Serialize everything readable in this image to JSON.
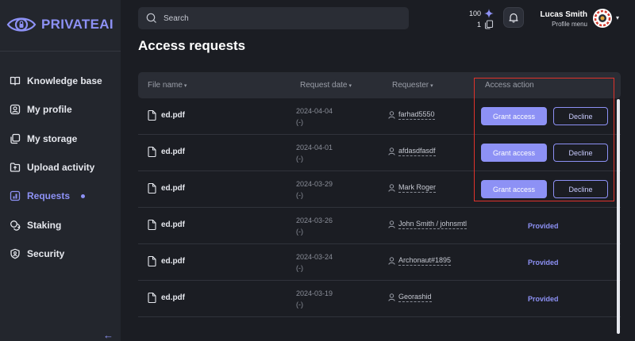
{
  "app": {
    "name": "PRIVATEAI",
    "brand_color": "#8d91f5"
  },
  "sidebar": {
    "items": [
      {
        "label": "Knowledge base",
        "icon": "book-icon"
      },
      {
        "label": "My profile",
        "icon": "profile-icon"
      },
      {
        "label": "My storage",
        "icon": "storage-icon"
      },
      {
        "label": "Upload activity",
        "icon": "upload-folder-icon"
      },
      {
        "label": "Requests",
        "icon": "requests-icon",
        "active": true
      },
      {
        "label": "Staking",
        "icon": "coins-icon"
      },
      {
        "label": "Security",
        "icon": "shield-icon"
      }
    ],
    "collapse_label": "←"
  },
  "header": {
    "search_placeholder": "Search",
    "tokens": "100",
    "files": "1",
    "user_name": "Lucas Smith",
    "user_menu": "Profile menu",
    "caret": "▾"
  },
  "page_title": "Access requests",
  "table": {
    "columns": {
      "file_name": "File name",
      "request_date": "Request date",
      "requester": "Requester",
      "access_action": "Access action",
      "sort_arrow": "▾"
    },
    "grant_label": "Grant access",
    "decline_label": "Decline",
    "provided_label": "Provided",
    "rows": [
      {
        "file": "ed.pdf",
        "date": "2024-04-04",
        "sub": "(-)",
        "requester": "farhad5550",
        "status": "pending"
      },
      {
        "file": "ed.pdf",
        "date": "2024-04-01",
        "sub": "(-)",
        "requester": "afdasdfasdf",
        "status": "pending"
      },
      {
        "file": "ed.pdf",
        "date": "2024-03-29",
        "sub": "(-)",
        "requester": "Mark Roger",
        "status": "pending"
      },
      {
        "file": "ed.pdf",
        "date": "2024-03-26",
        "sub": "(-)",
        "requester": "John Smith / johnsmtl",
        "status": "provided"
      },
      {
        "file": "ed.pdf",
        "date": "2024-03-24",
        "sub": "(-)",
        "requester": "Archonaut#1895",
        "status": "provided"
      },
      {
        "file": "ed.pdf",
        "date": "2024-03-19",
        "sub": "(-)",
        "requester": "Georashid",
        "status": "provided"
      }
    ]
  }
}
